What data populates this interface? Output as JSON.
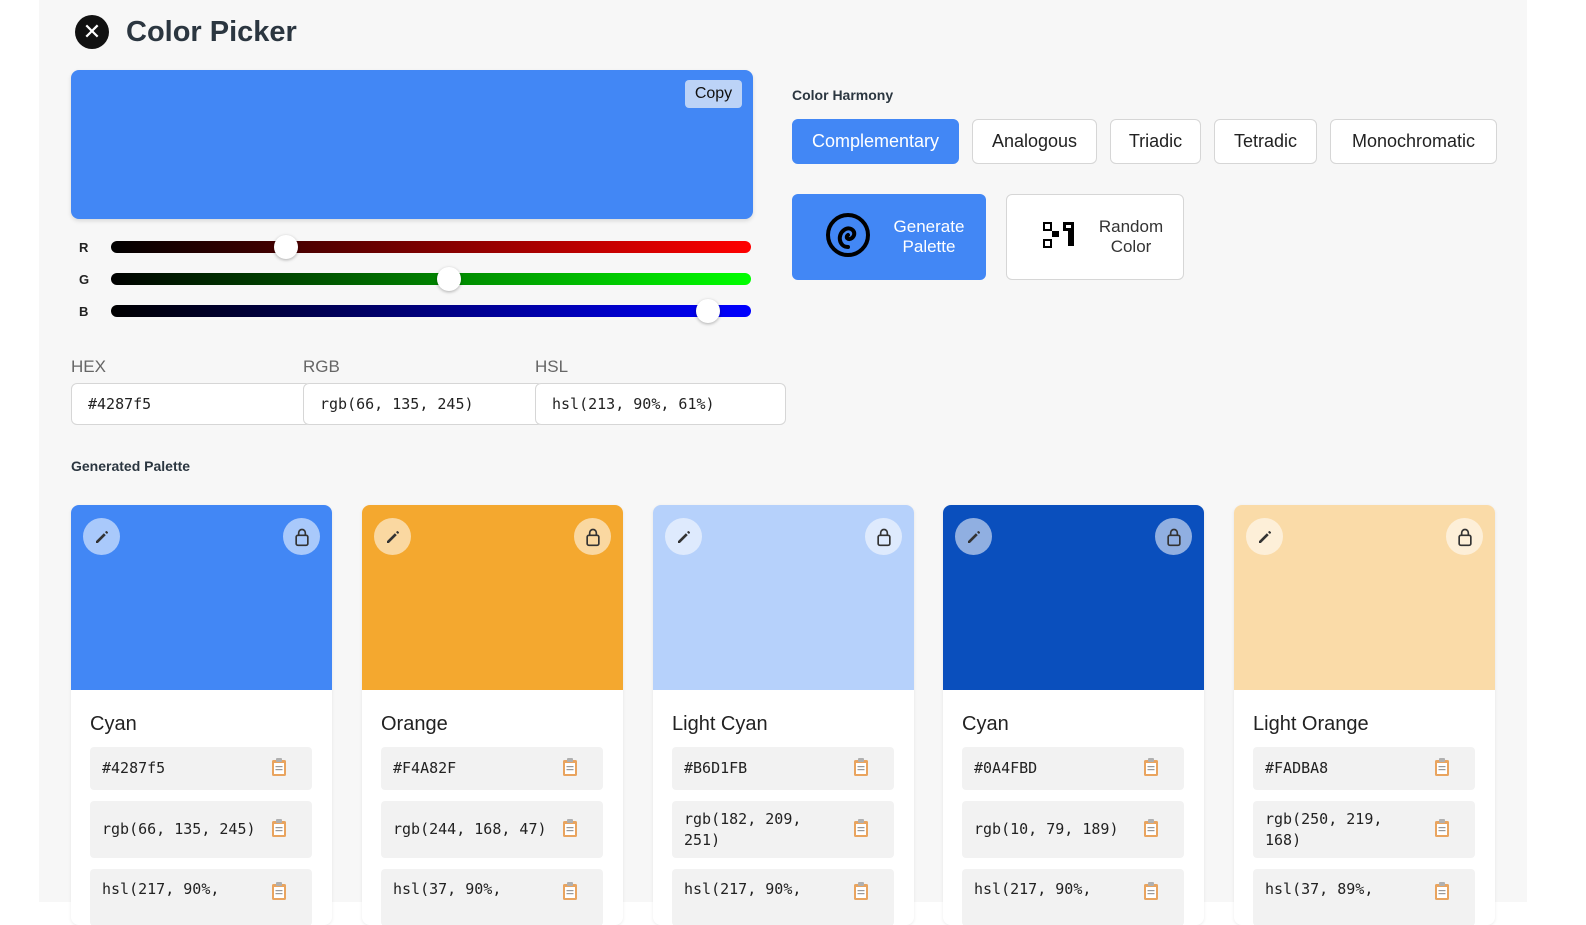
{
  "header": {
    "title": "Color Picker",
    "close_icon": "close-icon"
  },
  "current_color": {
    "preview_hex": "#4287f5",
    "copy_label": "Copy",
    "r": 66,
    "g": 135,
    "b": 245,
    "max": 255
  },
  "sliders": {
    "r_label": "R",
    "g_label": "G",
    "b_label": "B"
  },
  "fields": {
    "hex_label": "HEX",
    "hex_value": "#4287f5",
    "rgb_label": "RGB",
    "rgb_value": "rgb(66, 135, 245)",
    "hsl_label": "HSL",
    "hsl_value": "hsl(213, 90%, 61%)"
  },
  "harmony": {
    "title": "Color Harmony",
    "options": [
      "Complementary",
      "Analogous",
      "Triadic",
      "Tetradic",
      "Monochromatic"
    ],
    "active": "Complementary"
  },
  "actions": {
    "generate_label": "Generate Palette",
    "generate_icon": "palette-icon",
    "random_label": "Random Color",
    "random_icon": "shuffle-icon"
  },
  "palette": {
    "title": "Generated Palette",
    "edit_icon": "pencil-icon",
    "lock_icon": "lock-icon",
    "copy_icon": "clipboard-icon",
    "cards": [
      {
        "name": "Cyan",
        "color": "#4287f5",
        "hex": "#4287f5",
        "rgb": "rgb(66, 135, 245)",
        "hsl": "hsl(217, 90%,"
      },
      {
        "name": "Orange",
        "color": "#f4a82f",
        "hex": "#F4A82F",
        "rgb": "rgb(244, 168, 47)",
        "hsl": "hsl(37, 90%,"
      },
      {
        "name": "Light Cyan",
        "color": "#b6d1fb",
        "hex": "#B6D1FB",
        "rgb": "rgb(182, 209, 251)",
        "hsl": "hsl(217, 90%,"
      },
      {
        "name": "Cyan",
        "color": "#0a4fbd",
        "hex": "#0A4FBD",
        "rgb": "rgb(10, 79, 189)",
        "hsl": "hsl(217, 90%,"
      },
      {
        "name": "Light Orange",
        "color": "#fadba8",
        "hex": "#FADBA8",
        "rgb": "rgb(250, 219, 168)",
        "hsl": "hsl(37, 89%,"
      }
    ]
  }
}
